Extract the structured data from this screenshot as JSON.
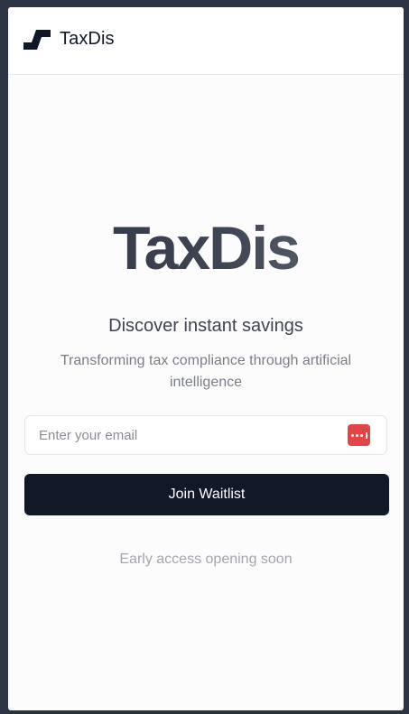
{
  "header": {
    "brand_name": "TaxDis",
    "logo_icon": "taxdis-logo-icon"
  },
  "hero": {
    "title": "TaxDis",
    "tagline": "Discover instant savings",
    "subtitle": "Transforming tax compliance through artificial intelligence"
  },
  "form": {
    "email_placeholder": "Enter your email",
    "email_value": "",
    "password_manager_icon": "password-manager-icon",
    "submit_label": "Join Waitlist"
  },
  "footer": {
    "note": "Early access opening soon"
  },
  "colors": {
    "page_background": "#fcfcfd",
    "outer_frame": "#2b3242",
    "button_background": "#111827",
    "password_icon": "#e24545"
  }
}
